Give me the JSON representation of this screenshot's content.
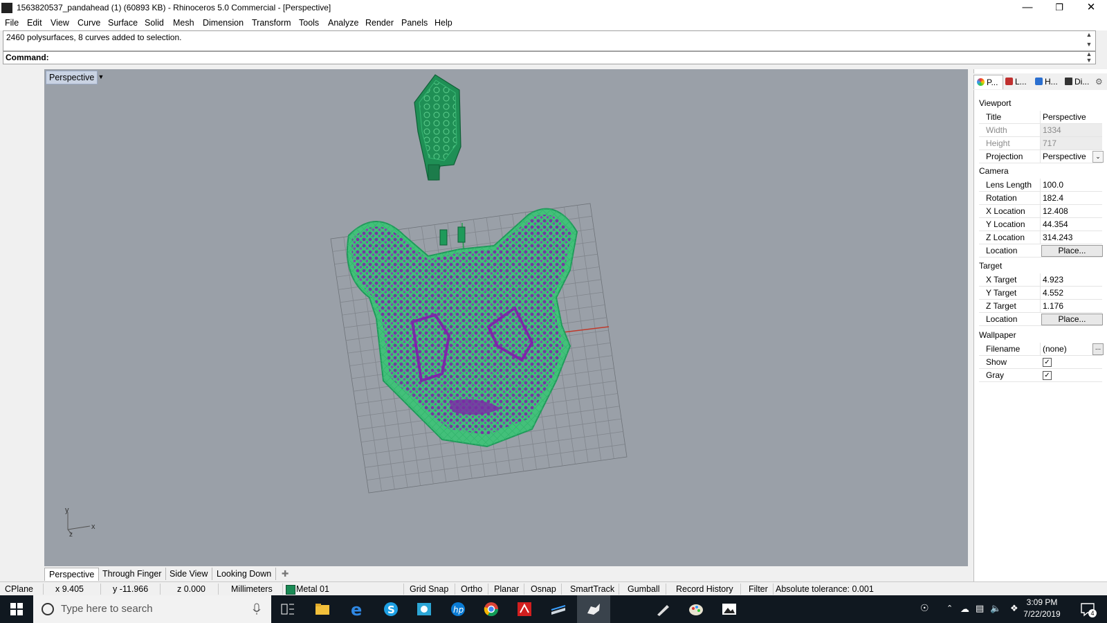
{
  "window": {
    "title": "1563820537_pandahead (1) (60893 KB) - Rhinoceros 5.0 Commercial - [Perspective]",
    "minimize_icon": "minimize-icon",
    "restore_icon": "restore-icon",
    "close_icon": "close-icon"
  },
  "menu": [
    "File",
    "Edit",
    "View",
    "Curve",
    "Surface",
    "Solid",
    "Mesh",
    "Dimension",
    "Transform",
    "Tools",
    "Analyze",
    "Render",
    "Panels",
    "Help"
  ],
  "command": {
    "history": "2460 polysurfaces, 8 curves added to selection.",
    "prompt": "Command:"
  },
  "viewport": {
    "title": "Perspective",
    "axis_y": "y",
    "axis_x": "x",
    "axis_z": "z",
    "colors": {
      "background": "#9aa0a8",
      "grid": "#7d8288",
      "object": "#1f9a5a",
      "selected": "#8a2ab0"
    }
  },
  "viewport_tabs": [
    "Perspective",
    "Through Finger",
    "Side View",
    "Looking Down"
  ],
  "status": {
    "cplane": "CPlane",
    "x": "x 9.405",
    "y": "y -11.966",
    "z": "z 0.000",
    "units": "Millimeters",
    "layer": "Metal 01",
    "layer_color": "#1a8a55",
    "toggles": [
      "Grid Snap",
      "Ortho",
      "Planar",
      "Osnap",
      "SmartTrack",
      "Gumball",
      "Record History",
      "Filter"
    ],
    "tolerance": "Absolute tolerance: 0.001"
  },
  "panel": {
    "tabs": [
      "P...",
      "L...",
      "H...",
      "Di..."
    ],
    "viewport_section": "Viewport",
    "viewport_rows": [
      {
        "label": "Title",
        "value": "Perspective"
      },
      {
        "label": "Width",
        "value": "1334"
      },
      {
        "label": "Height",
        "value": "717"
      },
      {
        "label": "Projection",
        "value": "Perspective"
      }
    ],
    "camera_section": "Camera",
    "camera_rows": [
      {
        "label": "Lens Length",
        "value": "100.0"
      },
      {
        "label": "Rotation",
        "value": "182.4"
      },
      {
        "label": "X Location",
        "value": "12.408"
      },
      {
        "label": "Y Location",
        "value": "44.354"
      },
      {
        "label": "Z Location",
        "value": "314.243"
      },
      {
        "label": "Location",
        "value": "Place..."
      }
    ],
    "target_section": "Target",
    "target_rows": [
      {
        "label": "X Target",
        "value": "4.923"
      },
      {
        "label": "Y Target",
        "value": "4.552"
      },
      {
        "label": "Z Target",
        "value": "1.176"
      },
      {
        "label": "Location",
        "value": "Place..."
      }
    ],
    "wallpaper_section": "Wallpaper",
    "wallpaper_rows": [
      {
        "label": "Filename",
        "value": "(none)",
        "button": "..."
      },
      {
        "label": "Show",
        "checked": true
      },
      {
        "label": "Gray",
        "checked": true
      }
    ]
  },
  "taskbar": {
    "search_placeholder": "Type here to search",
    "time": "3:09 PM",
    "date": "7/22/2019",
    "notification_count": "4"
  }
}
